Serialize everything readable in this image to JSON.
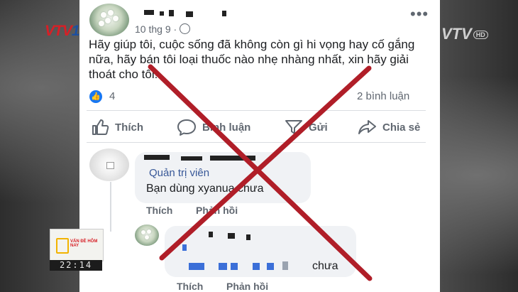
{
  "channel": {
    "logo_main": "VTV",
    "logo_num": "1",
    "watermark": "VTV",
    "watermark_sub": "HD"
  },
  "post": {
    "time": "10 thg 9 ·",
    "text": "Hãy giúp tôi, cuộc sống đã không còn gì hi vọng hay cố gắng nữa, hãy bán tôi loại thuốc nào nhẹ nhàng nhất, xin hãy giải thoát cho tôi!",
    "like_count": "4",
    "comment_count": "2 bình luận",
    "more_icon": "more-options-icon"
  },
  "actions": {
    "like": "Thích",
    "comment": "Bình luận",
    "send": "Gửi",
    "share": "Chia sẻ"
  },
  "comment1": {
    "role": "Quản trị viên",
    "text": "Bạn dùng xyanua chưa",
    "like": "Thích",
    "reply": "Phản hồi"
  },
  "comment2": {
    "text": "chưa",
    "like": "Thích",
    "reply": "Phản hồi"
  },
  "overlay": {
    "box_title": "VẤN ĐỀ HÔM NAY",
    "clock": "22:14"
  },
  "colors": {
    "cross": "#b01e28",
    "link": "#385898",
    "facebook_blue": "#1877f2"
  }
}
